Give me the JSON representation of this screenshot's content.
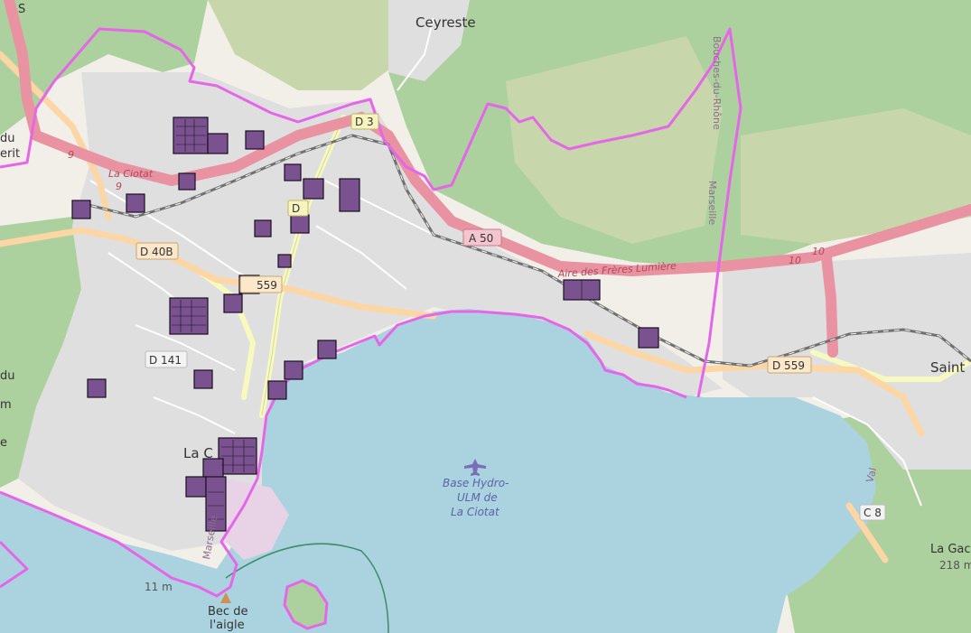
{
  "colors": {
    "sea": "#aad3df",
    "land": "#f2efe9",
    "urban": "#e0dfdf",
    "forest": "#add19e",
    "scrub": "#c8d7ab",
    "motorway": "#e892a2",
    "primary": "#fcd6a4",
    "secondary": "#f7fabf",
    "boundary": "#e566e8",
    "parcel_fill": "#7b5290",
    "parcel_stroke": "#1a1020",
    "rail": "#707070"
  },
  "labels": {
    "ceyreste": "Ceyreste",
    "la_ciotat_road": "La Ciotat",
    "la_ciotat_town": "La C",
    "saint": "Saint",
    "bouches_du_rhone": "Bouches-du-Rhône",
    "marseille_vertical": "Marseille",
    "marseille_port": "Marseille",
    "du_top": "du",
    "erit": "erit",
    "du_left": "du",
    "m_left": "m",
    "e_left": "e",
    "base_hydro_1": "Base Hydro-",
    "base_hydro_2": "ULM de",
    "base_hydro_3": "La Ciotat",
    "aire": "Aire des Frères Lumière",
    "bec_1": "Bec de",
    "bec_2": "l'aigle",
    "elev_11": "11 m",
    "la_gac": "La Gac",
    "elev_218": "218 m",
    "val": "Val",
    "num_9_a": "9",
    "num_9_b": "9",
    "num_10_a": "10",
    "num_10_b": "10",
    "s_top": "S"
  },
  "road_shields": {
    "d3": "D 3",
    "d40b": "D 40B",
    "d559_west": "559",
    "d141": "D 141",
    "a50": "A 50",
    "d559_east": "D 559",
    "c8": "C 8",
    "d3_mid": "D"
  }
}
